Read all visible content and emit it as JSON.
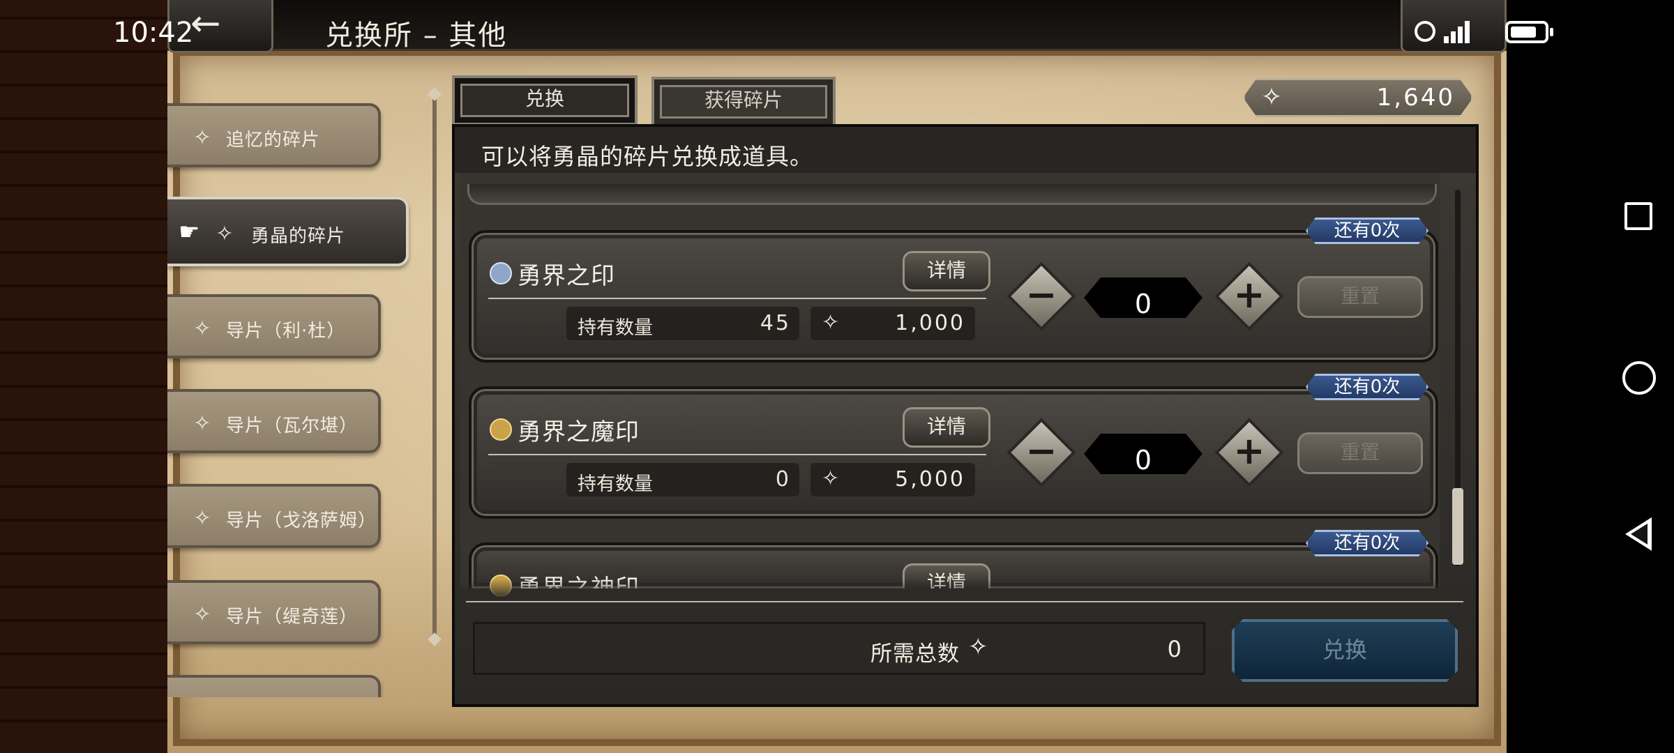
{
  "status_bar": {
    "time": "10:42"
  },
  "header": {
    "title": "兑换所 – 其他"
  },
  "categories": [
    {
      "label": "追忆的碎片"
    },
    {
      "label": "勇晶的碎片"
    },
    {
      "label": "导片（利·杜）"
    },
    {
      "label": "导片（瓦尔堪）"
    },
    {
      "label": "导片（戈洛萨姆）"
    },
    {
      "label": "导片（缇奇莲）"
    }
  ],
  "tabs": [
    {
      "label": "兑换",
      "active": true
    },
    {
      "label": "获得碎片",
      "active": false
    }
  ],
  "currency": {
    "icon": "shard-icon",
    "value": "1,640"
  },
  "description": "可以将勇晶的碎片兑换成道具。",
  "items": [
    {
      "badge": "还有0次",
      "name": "勇界之印",
      "detail_label": "详情",
      "owned_label": "持有数量",
      "owned": "45",
      "cost": "1,000",
      "qty": "0",
      "reset_label": "重置",
      "icon_color": "#8fa6c8"
    },
    {
      "badge": "还有0次",
      "name": "勇界之魔印",
      "detail_label": "详情",
      "owned_label": "持有数量",
      "owned": "0",
      "cost": "5,000",
      "qty": "0",
      "reset_label": "重置",
      "icon_color": "#c9a24a"
    },
    {
      "badge": "还有0次",
      "name": "勇界之神印",
      "detail_label": "详情",
      "icon_color": "#c9a24a"
    }
  ],
  "footer": {
    "total_label": "所需总数",
    "total_value": "0",
    "exchange_label": "兑换"
  },
  "colors": {
    "accent_blue": "#233a66",
    "panel_dark": "#2a2724"
  }
}
